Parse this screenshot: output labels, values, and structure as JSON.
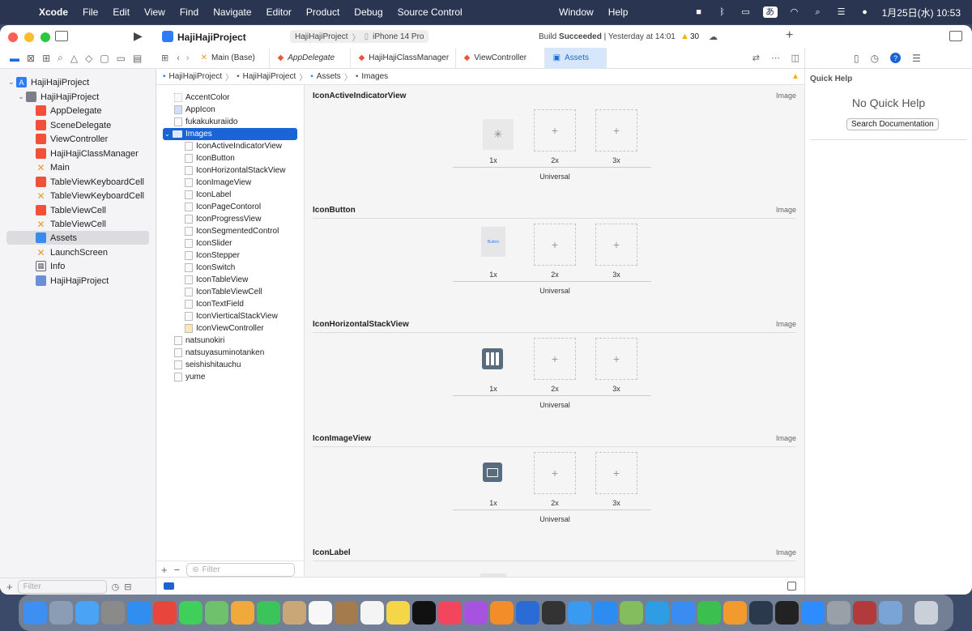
{
  "menubar": {
    "app": "Xcode",
    "items": [
      "File",
      "Edit",
      "View",
      "Find",
      "Navigate",
      "Editor",
      "Product",
      "Debug",
      "Source Control"
    ],
    "center_items": [
      "Window",
      "Help"
    ],
    "ime": "あ",
    "clock": "1月25日(水)  10:53"
  },
  "toolbar": {
    "project_name": "HajiHajiProject",
    "scheme": "HajiHajiProject",
    "device": "iPhone 14 Pro",
    "build_status_prefix": "Build",
    "build_status": "Succeeded",
    "build_time": "| Yesterday at 14:01",
    "warning_count": "30"
  },
  "navigator": {
    "items": [
      {
        "label": "HajiHajiProject",
        "kind": "project"
      },
      {
        "label": "HajiHajiProject",
        "kind": "folder"
      },
      {
        "label": "AppDelegate",
        "kind": "swift"
      },
      {
        "label": "SceneDelegate",
        "kind": "swift"
      },
      {
        "label": "ViewController",
        "kind": "swift"
      },
      {
        "label": "HajiHajiClassManager",
        "kind": "swift"
      },
      {
        "label": "Main",
        "kind": "xib"
      },
      {
        "label": "TableViewKeyboardCell",
        "kind": "swift"
      },
      {
        "label": "TableViewKeyboardCell",
        "kind": "xib"
      },
      {
        "label": "TableViewCell",
        "kind": "swift"
      },
      {
        "label": "TableViewCell",
        "kind": "xib"
      },
      {
        "label": "Assets",
        "kind": "assets"
      },
      {
        "label": "LaunchScreen",
        "kind": "xib"
      },
      {
        "label": "Info",
        "kind": "plist"
      },
      {
        "label": "HajiHajiProject",
        "kind": "target"
      }
    ],
    "filter_placeholder": "Filter"
  },
  "tabs": [
    {
      "label": "Main (Base)"
    },
    {
      "label": "AppDelegate"
    },
    {
      "label": "HajiHajiClassManager"
    },
    {
      "label": "ViewController"
    },
    {
      "label": "Assets"
    }
  ],
  "breadcrumb": [
    "HajiHajiProject",
    "HajiHajiProject",
    "Assets",
    "Images"
  ],
  "asset_list": {
    "items": [
      {
        "label": "AccentColor",
        "indent": 0
      },
      {
        "label": "AppIcon",
        "indent": 0
      },
      {
        "label": "fukakukuraiido",
        "indent": 0
      },
      {
        "label": "Images",
        "indent": 0,
        "selected": true
      },
      {
        "label": "IconActiveIndicatorView",
        "indent": 1
      },
      {
        "label": "IconButton",
        "indent": 1
      },
      {
        "label": "IconHorizontalStackView",
        "indent": 1
      },
      {
        "label": "IconImageView",
        "indent": 1
      },
      {
        "label": "IconLabel",
        "indent": 1
      },
      {
        "label": "IconPageContorol",
        "indent": 1
      },
      {
        "label": "IconProgressView",
        "indent": 1
      },
      {
        "label": "IconSegmentedControl",
        "indent": 1
      },
      {
        "label": "IconSlider",
        "indent": 1
      },
      {
        "label": "IconStepper",
        "indent": 1
      },
      {
        "label": "IconSwitch",
        "indent": 1
      },
      {
        "label": "IconTableView",
        "indent": 1
      },
      {
        "label": "IconTableViewCell",
        "indent": 1
      },
      {
        "label": "IconTextField",
        "indent": 1
      },
      {
        "label": "IconVierticalStackView",
        "indent": 1
      },
      {
        "label": "IconViewController",
        "indent": 1
      },
      {
        "label": "natsunokiri",
        "indent": 0
      },
      {
        "label": "natsuyasuminotanken",
        "indent": 0
      },
      {
        "label": "seishishitauchu",
        "indent": 0
      },
      {
        "label": "yume",
        "indent": 0
      }
    ],
    "filter_placeholder": "Filter"
  },
  "image_sets": [
    {
      "name": "IconActiveIndicatorView",
      "kind": "Image",
      "preview": "spinner"
    },
    {
      "name": "IconButton",
      "kind": "Image",
      "preview": "button",
      "preview_text": "Button"
    },
    {
      "name": "IconHorizontalStackView",
      "kind": "Image",
      "preview": "hstack"
    },
    {
      "name": "IconImageView",
      "kind": "Image",
      "preview": "imageview"
    },
    {
      "name": "IconLabel",
      "kind": "Image",
      "preview": "label"
    }
  ],
  "scales": [
    "1x",
    "2x",
    "3x"
  ],
  "universal_label": "Universal",
  "empty_slot_symbol": "+",
  "inspector": {
    "title": "Quick Help",
    "empty_message": "No Quick Help",
    "search_button": "Search Documentation"
  },
  "colors": {
    "accent": "#1b64d6",
    "swift": "#f05138",
    "xib": "#e89b2c"
  }
}
